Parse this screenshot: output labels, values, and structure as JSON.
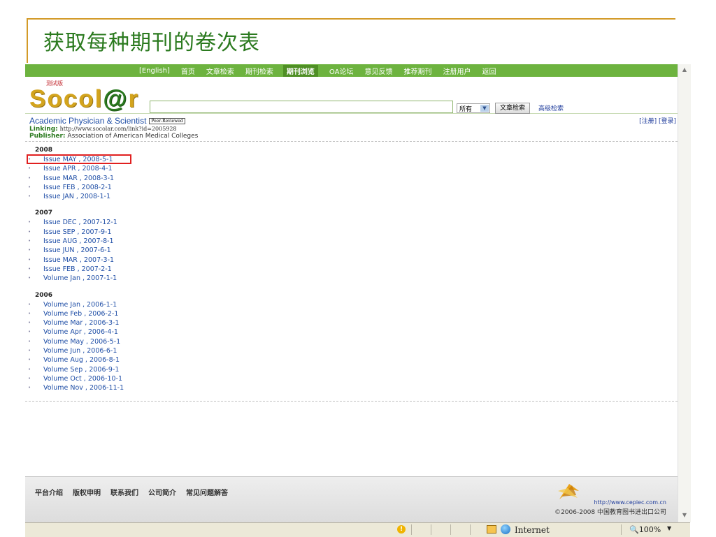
{
  "slide": {
    "title": "获取每种期刊的卷次表"
  },
  "nav": {
    "items": [
      {
        "label": "[English]"
      },
      {
        "label": "首页"
      },
      {
        "label": "文章检索"
      },
      {
        "label": "期刊检索"
      },
      {
        "label": "期刊浏览",
        "active": true
      },
      {
        "label": "OA论坛"
      },
      {
        "label": "意见反馈"
      },
      {
        "label": "推荐期刊"
      },
      {
        "label": "注册用户"
      },
      {
        "label": "返回"
      }
    ]
  },
  "header": {
    "logo_small": "测试版",
    "logo_text_left": "Socol",
    "logo_text_at": "@",
    "logo_text_right": "r",
    "search_value": "",
    "scope_selected": "所有",
    "search_button": "文章检索",
    "advanced_link": "高级检索",
    "register_link": "[注册]",
    "login_link": "[登录]"
  },
  "journal": {
    "title": "Academic Physician & Scientist",
    "badge": "Peer-Reviewed",
    "linking_label": "Linking:",
    "linking_url": "http://www.socolar.com/link?id=2005928",
    "publisher_label": "Publisher:",
    "publisher": "Association of American Medical Colleges"
  },
  "years": [
    {
      "year": "2008",
      "issues": [
        "Issue MAY , 2008-5-1",
        "Issue APR , 2008-4-1",
        "Issue MAR , 2008-3-1",
        "Issue FEB , 2008-2-1",
        "Issue JAN , 2008-1-1"
      ]
    },
    {
      "year": "2007",
      "issues": [
        "Issue DEC , 2007-12-1",
        "Issue SEP , 2007-9-1",
        "Issue AUG , 2007-8-1",
        "Issue JUN , 2007-6-1",
        "Issue MAR , 2007-3-1",
        "Issue FEB , 2007-2-1",
        "Volume Jan , 2007-1-1"
      ]
    },
    {
      "year": "2006",
      "issues": [
        "Volume Jan , 2006-1-1",
        "Volume Feb , 2006-2-1",
        "Volume Mar , 2006-3-1",
        "Volume Apr , 2006-4-1",
        "Volume May , 2006-5-1",
        "Volume Jun , 2006-6-1",
        "Volume Aug , 2006-8-1",
        "Volume Sep , 2006-9-1",
        "Volume Oct , 2006-10-1",
        "Volume Nov , 2006-11-1"
      ]
    }
  ],
  "footer": {
    "links": [
      "平台介绍",
      "版权申明",
      "联系我们",
      "公司简介",
      "常见问题解答"
    ],
    "url": "http://www.cepiec.com.cn",
    "copyright": "©2006-2008 中国教育图书进出口公司"
  },
  "statusbar": {
    "zone": "Internet",
    "zoom": "100%"
  },
  "colors": {
    "nav_green": "#6db33f",
    "title_green": "#2b7a1f",
    "link_blue": "#1f4ea6",
    "logo_gold": "#d3a41d",
    "highlight_red": "#e02020"
  }
}
